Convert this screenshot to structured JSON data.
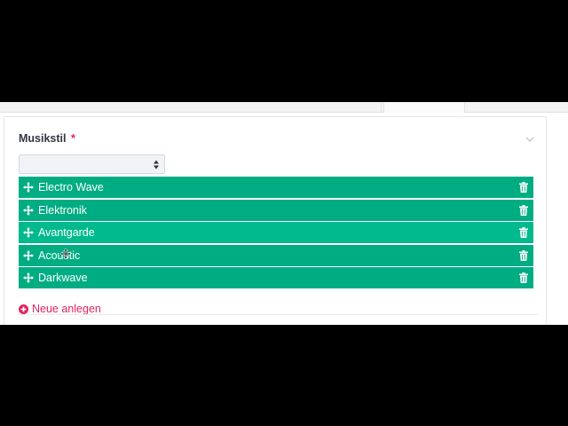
{
  "field": {
    "label": "Musikstil",
    "required_mark": "*",
    "select_value": ""
  },
  "items": [
    {
      "label": "Electro Wave"
    },
    {
      "label": "Elektronik"
    },
    {
      "label": "Avantgarde"
    },
    {
      "label": "Acoustic"
    },
    {
      "label": "Darkwave"
    }
  ],
  "actions": {
    "add_new_label": "Neue anlegen"
  },
  "colors": {
    "row": "#00ad83",
    "row_alt": "#00b98d",
    "accent": "#e0245e"
  },
  "icons": {
    "row_handle": "move-icon",
    "row_delete": "trash-icon",
    "collapse": "chevron-down-icon",
    "add": "plus-circle-icon"
  }
}
